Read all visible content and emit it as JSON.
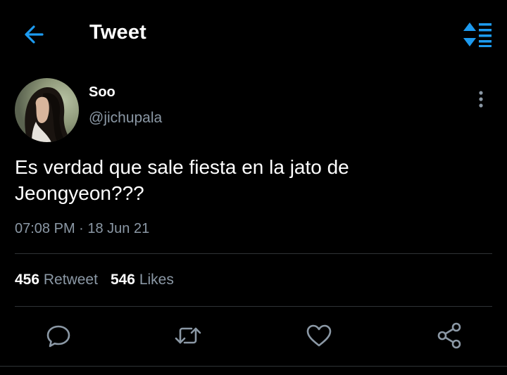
{
  "colors": {
    "background": "#000000",
    "accent": "#1d9bf0",
    "text_primary": "#ffffff",
    "text_secondary": "#8b98a5",
    "divider": "#2f3336"
  },
  "header": {
    "title": "Tweet",
    "back_icon": "arrow-left-icon",
    "toggle_icon": "timeline-sort-icon"
  },
  "tweet": {
    "display_name": "Soo",
    "handle": "@jichupala",
    "text_line1": "Es verdad que sale fiesta en la jato de",
    "text_line2": "Jeongyeon???",
    "timestamp": "07:08 PM · 18 Jun 21",
    "retweet_count": "456",
    "retweet_label": "Retweet",
    "like_count": "546",
    "like_label": "Likes"
  },
  "actions": [
    {
      "name": "reply",
      "icon": "reply-icon"
    },
    {
      "name": "retweet",
      "icon": "retweet-icon"
    },
    {
      "name": "like",
      "icon": "heart-icon"
    },
    {
      "name": "share",
      "icon": "share-icon"
    }
  ]
}
